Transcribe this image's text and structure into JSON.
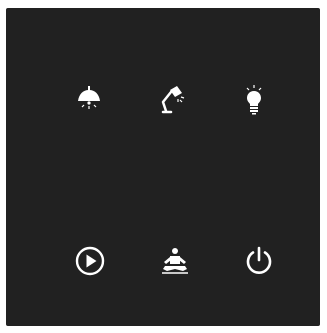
{
  "panel": {
    "background": "#212121",
    "icon_color": "#ffffff",
    "buttons": [
      {
        "id": "pendant-light",
        "icon": "pendant-lamp-icon"
      },
      {
        "id": "desk-lamp",
        "icon": "desk-lamp-icon"
      },
      {
        "id": "light-bulb",
        "icon": "light-bulb-icon"
      },
      {
        "id": "play",
        "icon": "play-circle-icon"
      },
      {
        "id": "relax-mode",
        "icon": "meditation-icon"
      },
      {
        "id": "power",
        "icon": "power-icon"
      }
    ]
  }
}
